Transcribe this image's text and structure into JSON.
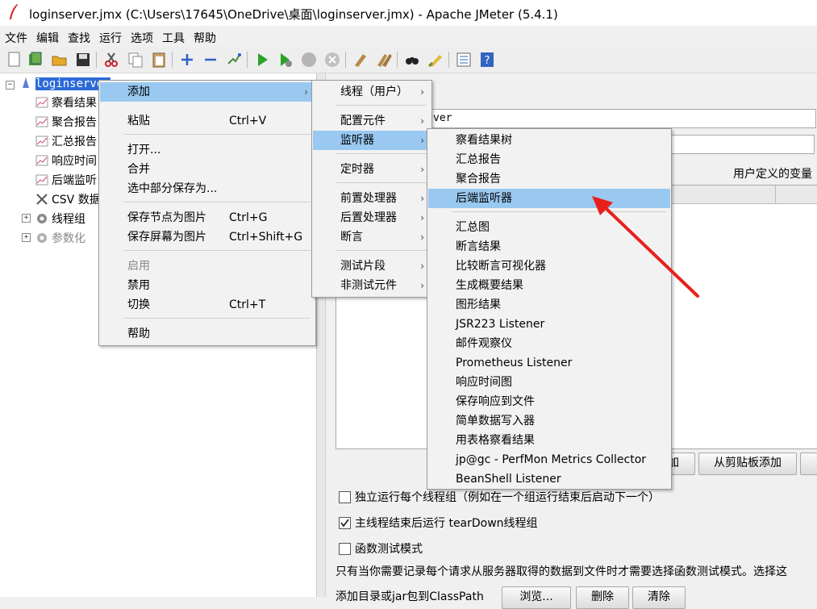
{
  "window": {
    "title": "loginserver.jmx (C:\\Users\\17645\\OneDrive\\桌面\\loginserver.jmx) - Apache JMeter (5.4.1)"
  },
  "menubar": {
    "items": [
      "文件",
      "编辑",
      "查找",
      "运行",
      "选项",
      "工具",
      "帮助"
    ]
  },
  "toolbar": {
    "icons": [
      "new-icon",
      "templates-icon",
      "open-icon",
      "save-icon",
      "cut-icon",
      "copy-icon",
      "paste-icon",
      "expand-icon",
      "collapse-icon",
      "toggle-icon",
      "start-icon",
      "start-no-pause-icon",
      "stop-icon",
      "shutdown-icon",
      "clear-icon",
      "clear-all-icon",
      "search-icon",
      "reset-search-icon",
      "function-helper-icon",
      "help-icon"
    ]
  },
  "tree": {
    "root": "loginserver",
    "children": [
      "察看结果",
      "聚合报告",
      "汇总报告",
      "响应时间",
      "后端监听",
      "CSV 数据",
      "线程组",
      "参数化"
    ]
  },
  "right_panel": {
    "name_value": "ver",
    "user_vars_label": "用户定义的变量",
    "add_button": "加",
    "add_clipboard_button": "从剪贴板添加",
    "checkbox_independent": {
      "label": "独立运行每个线程组（例如在一个组运行结束后启动下一个）",
      "checked": false
    },
    "checkbox_teardown": {
      "label": "主线程结束后运行 tearDown线程组",
      "checked": true
    },
    "checkbox_functional": {
      "label": "函数测试模式",
      "checked": false
    },
    "functional_note": "只有当你需要记录每个请求从服务器取得的数据到文件时才需要选择函数测试模式。选择这",
    "classpath_label": "添加目录或jar包到ClassPath",
    "browse_button": "浏览...",
    "delete_button": "删除",
    "clear_button": "清除"
  },
  "context_menu": {
    "add": "添加",
    "paste": "粘贴",
    "paste_shortcut": "Ctrl+V",
    "open": "打开...",
    "merge": "合并",
    "save_selection": "选中部分保存为...",
    "save_node_image": "保存节点为图片",
    "save_node_image_shortcut": "Ctrl+G",
    "save_screen_image": "保存屏幕为图片",
    "save_screen_image_shortcut": "Ctrl+Shift+G",
    "enable": "启用",
    "disable": "禁用",
    "toggle": "切换",
    "toggle_shortcut": "Ctrl+T",
    "help": "帮助"
  },
  "add_submenu": {
    "threads": "线程（用户）",
    "config": "配置元件",
    "listener": "监听器",
    "timer": "定时器",
    "pre": "前置处理器",
    "post": "后置处理器",
    "assertion": "断言",
    "fragment": "测试片段",
    "non_test": "非测试元件"
  },
  "listener_submenu": {
    "items": [
      "察看结果树",
      "汇总报告",
      "聚合报告",
      "后端监听器",
      "汇总图",
      "断言结果",
      "比较断言可视化器",
      "生成概要结果",
      "图形结果",
      "JSR223 Listener",
      "邮件观察仪",
      "Prometheus Listener",
      "响应时间图",
      "保存响应到文件",
      "简单数据写入器",
      "用表格察看结果",
      "jp@gc - PerfMon Metrics Collector",
      "BeanShell Listener"
    ],
    "highlighted_index": 3
  },
  "colors": {
    "highlight": "#99c9f1",
    "selection": "#2d6ad8",
    "annotation_arrow": "#e8201c"
  }
}
